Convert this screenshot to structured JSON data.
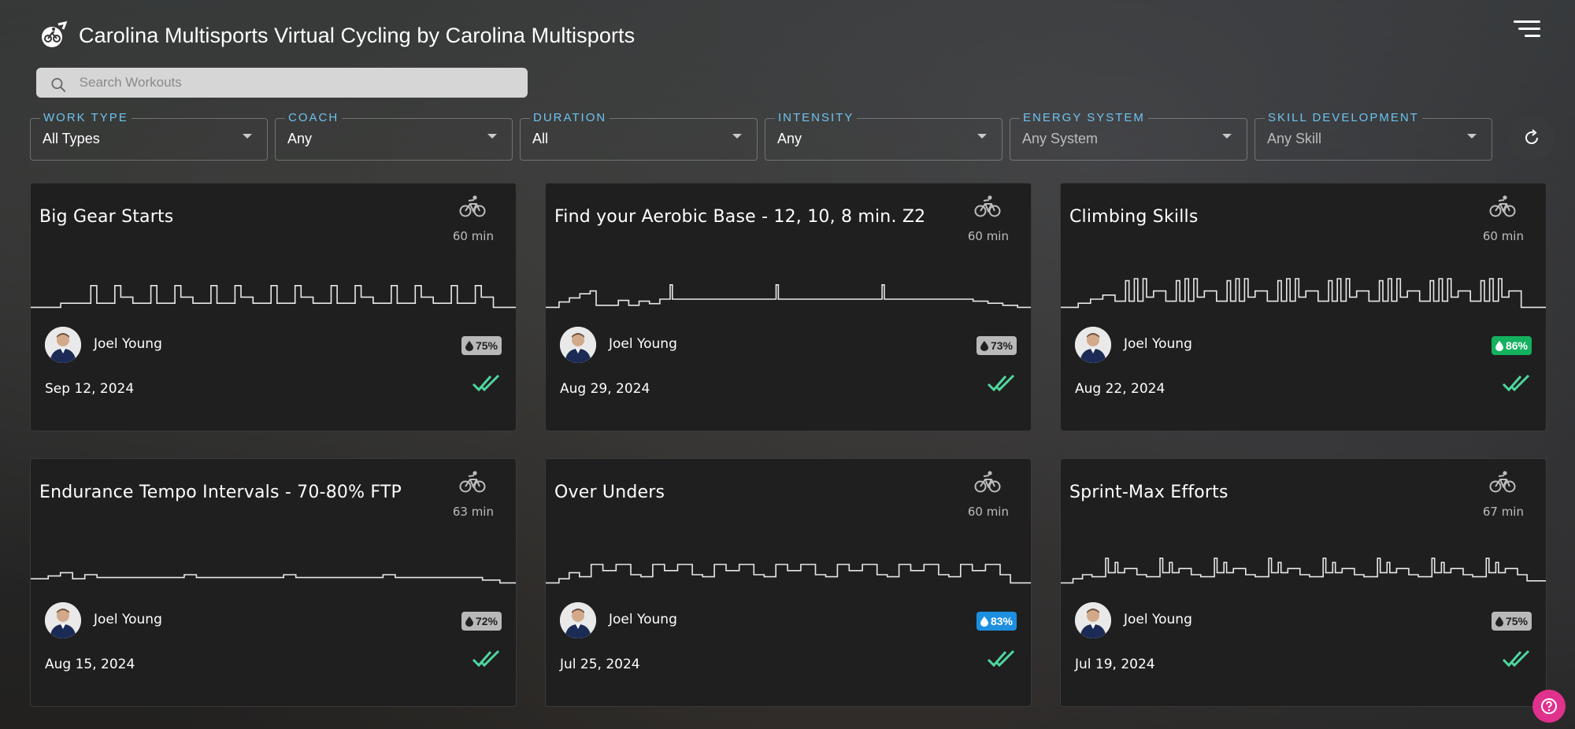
{
  "header": {
    "title": "Carolina Multisports Virtual Cycling by Carolina Multisports",
    "logo_icon": "cyclist-globe-icon",
    "menu_icon": "filter-menu-icon"
  },
  "search": {
    "placeholder": "Search Workouts",
    "value": ""
  },
  "filters": [
    {
      "label": "WORK TYPE",
      "value": "All Types",
      "muted": false
    },
    {
      "label": "COACH",
      "value": "Any",
      "muted": false
    },
    {
      "label": "DURATION",
      "value": "All",
      "muted": false
    },
    {
      "label": "INTENSITY",
      "value": "Any",
      "muted": false
    },
    {
      "label": "ENERGY SYSTEM",
      "value": "Any System",
      "muted": true
    },
    {
      "label": "SKILL DEVELOPMENT",
      "value": "Any Skill",
      "muted": true
    }
  ],
  "colors": {
    "accent": "#6ec3f0",
    "check": "#4fd6a0",
    "badge_green": "#14b15f",
    "badge_blue": "#1d8fe0",
    "badge_gray": "#b9b9b9",
    "help": "#e0318c"
  },
  "workouts": [
    {
      "title": "Big Gear Starts",
      "duration": "60 min",
      "coach": "Joel Young",
      "intensity": "75%",
      "badge": "gray",
      "date": "Sep 12, 2024",
      "completed": true
    },
    {
      "title": "Find your Aerobic Base - 12, 10, 8 min. Z2",
      "duration": "60 min",
      "coach": "Joel Young",
      "intensity": "73%",
      "badge": "gray",
      "date": "Aug 29, 2024",
      "completed": true
    },
    {
      "title": "Climbing Skills",
      "duration": "60 min",
      "coach": "Joel Young",
      "intensity": "86%",
      "badge": "green",
      "date": "Aug 22, 2024",
      "completed": true
    },
    {
      "title": "Endurance Tempo Intervals - 70-80% FTP",
      "duration": "63 min",
      "coach": "Joel Young",
      "intensity": "72%",
      "badge": "gray",
      "date": "Aug 15, 2024",
      "completed": true
    },
    {
      "title": "Over Unders",
      "duration": "60 min",
      "coach": "Joel Young",
      "intensity": "83%",
      "badge": "blue",
      "date": "Jul 25, 2024",
      "completed": true
    },
    {
      "title": "Sprint-Max Efforts",
      "duration": "67 min",
      "coach": "Joel Young",
      "intensity": "75%",
      "badge": "gray",
      "date": "Jul 19, 2024",
      "completed": true
    }
  ]
}
